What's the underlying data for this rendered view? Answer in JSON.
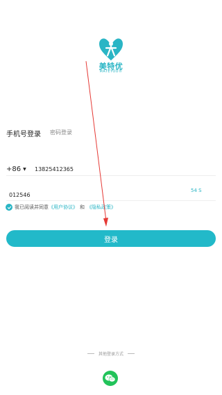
{
  "brand": {
    "name_cn": "美特优",
    "name_en": "MATEYOU®"
  },
  "tabs": {
    "phone_login": "手机号登录",
    "password_login": "密码登录"
  },
  "phone": {
    "country_code": "+86",
    "number": "13825412365"
  },
  "code": {
    "value": "012546",
    "countdown": "54 S"
  },
  "agreement": {
    "prefix": "我已阅读并同意",
    "user_agreement": "《用户协议》",
    "and": "和",
    "privacy_policy": "《隐私政策》"
  },
  "login_button": "登录",
  "other_login": {
    "label": "其他登录方式",
    "wechat_icon": "wechat-icon"
  },
  "colors": {
    "accent": "#22b9c9",
    "wechat": "#22c35a",
    "annotation": "#e53935"
  }
}
